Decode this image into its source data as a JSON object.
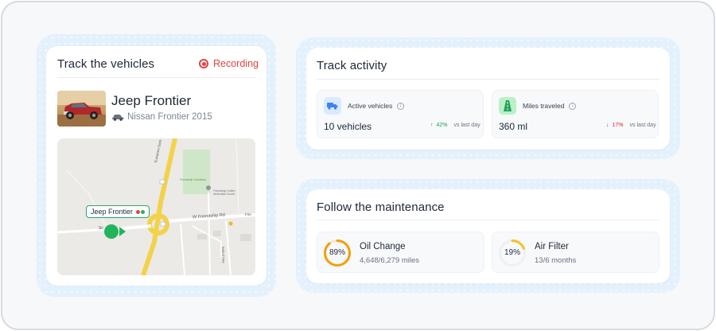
{
  "colors": {
    "accent_blue": "#3b82f6",
    "recording_red": "#e0443e",
    "trend_up": "#16a34a",
    "trend_down": "#dc2626",
    "route_yellow": "#f2d24a",
    "vehicle_green": "#22b45b",
    "ring_oil": "#f59e0b",
    "ring_filter": "#fbbf24"
  },
  "tracker": {
    "title": "Track the vehicles",
    "recording_label": "Recording",
    "recording_icon": "record-icon",
    "vehicle": {
      "name": "Jeep Frontier",
      "sub_label": "Nissan Frontier 2015",
      "sub_icon": "car-icon"
    },
    "map": {
      "marker_label": "Jeep Frontier",
      "road_labels": {
        "w_friendship": "W Friendship Rd",
        "friendship_cemetery": "Friendship Cemetery",
        "friendship_united": "Friendship United Methodist Church",
        "suwanee_dam": "Suwanee Dam Rd",
        "buford_highway": "Buford Hwy",
        "frie": "Frie",
        "sc": "Sc"
      }
    }
  },
  "activity": {
    "title": "Track activity",
    "stats": [
      {
        "icon": "truck-icon",
        "label": "Active vehicles",
        "value": "10 vehicles",
        "trend_direction": "up",
        "trend_value": "42%",
        "trend_compare": "vs last day"
      },
      {
        "icon": "road-icon",
        "label": "Miles traveled",
        "value": "360 ml",
        "trend_direction": "down",
        "trend_value": "17%",
        "trend_compare": "vs last day"
      }
    ]
  },
  "maintenance": {
    "title": "Follow the maintenance",
    "items": [
      {
        "progress_label": "89%",
        "progress": 0.89,
        "title": "Oil Change",
        "detail": "4,648/6,279 miles"
      },
      {
        "progress_label": "19%",
        "progress": 0.19,
        "title": "Air Filter",
        "detail": "13/6 months"
      }
    ]
  }
}
